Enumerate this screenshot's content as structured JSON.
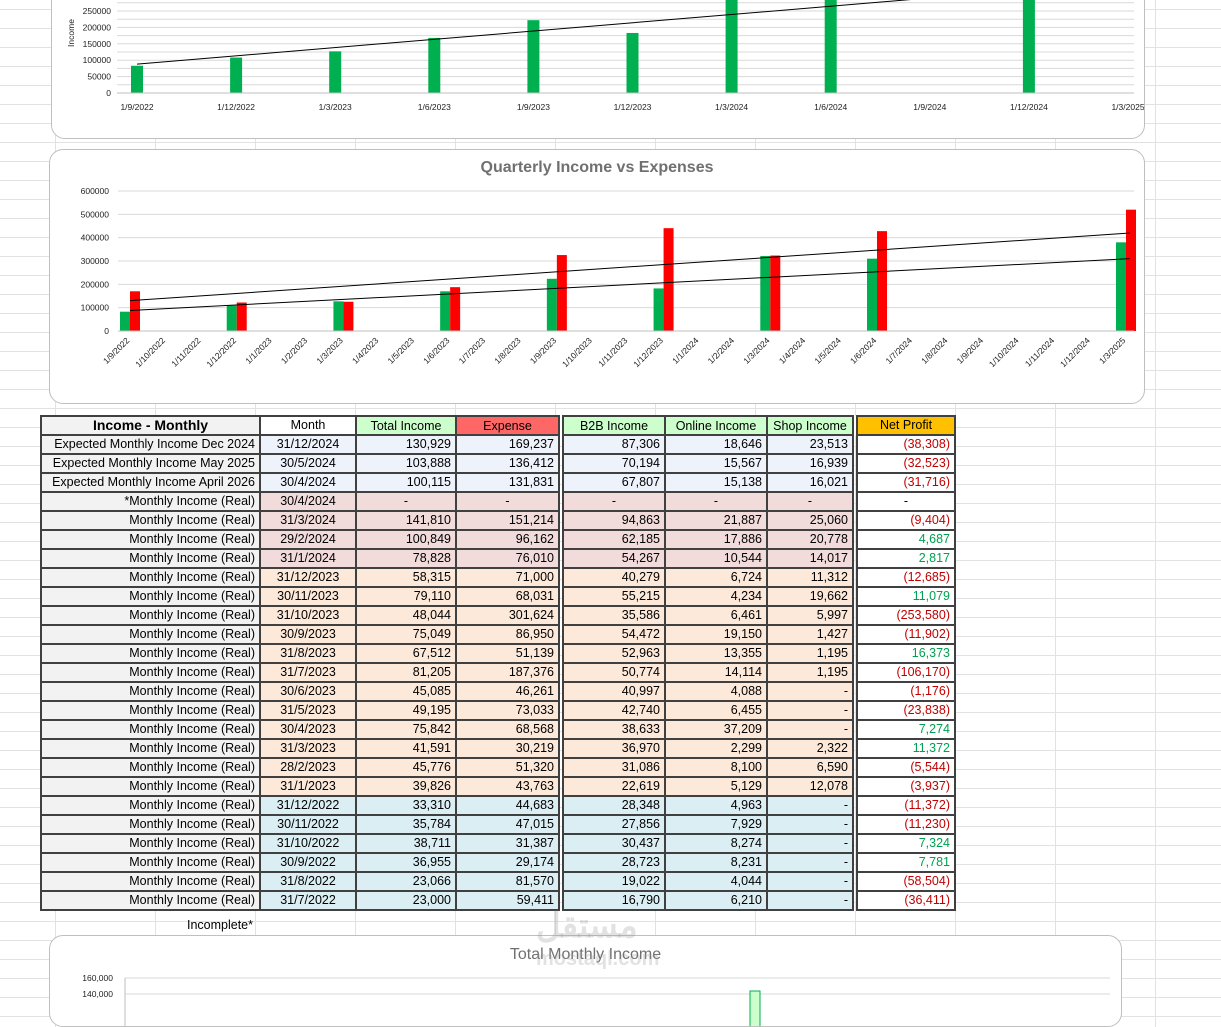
{
  "charts": {
    "top": {
      "ylabel": "Income",
      "y_ticks": [
        "250000",
        "200000",
        "150000",
        "100000",
        "50000",
        "0"
      ],
      "x_ticks": [
        "1/9/2022",
        "1/12/2022",
        "1/3/2023",
        "1/6/2023",
        "1/9/2023",
        "1/12/2023",
        "1/3/2024",
        "1/6/2024",
        "1/9/2024",
        "1/12/2024",
        "1/3/2025"
      ]
    },
    "quarterly": {
      "title": "Quarterly Income vs Expenses",
      "y_ticks": [
        "600000",
        "500000",
        "400000",
        "300000",
        "200000",
        "100000",
        "0"
      ],
      "x_ticks": [
        "1/9/2022",
        "1/10/2022",
        "1/11/2022",
        "1/12/2022",
        "1/1/2023",
        "1/2/2023",
        "1/3/2023",
        "1/4/2023",
        "1/5/2023",
        "1/6/2023",
        "1/7/2023",
        "1/8/2023",
        "1/9/2023",
        "1/10/2023",
        "1/11/2023",
        "1/12/2023",
        "1/1/2024",
        "1/2/2024",
        "1/3/2024",
        "1/4/2024",
        "1/5/2024",
        "1/6/2024",
        "1/7/2024",
        "1/8/2024",
        "1/9/2024",
        "1/10/2024",
        "1/11/2024",
        "1/12/2024",
        "1/3/2025"
      ]
    },
    "bottom": {
      "title": "Total Monthly Income",
      "y_ticks": [
        "160,000",
        "140,000"
      ]
    }
  },
  "chart_data": [
    {
      "type": "bar",
      "title": "",
      "ylabel": "Income",
      "ylim": [
        0,
        250000
      ],
      "categories": [
        "1/9/2022",
        "1/12/2022",
        "1/3/2023",
        "1/6/2023",
        "1/9/2023",
        "1/12/2023",
        "1/3/2024",
        "1/6/2024",
        "1/9/2024",
        "1/12/2024",
        "1/3/2025"
      ],
      "values": [
        83000,
        108000,
        127000,
        168000,
        222000,
        183000,
        290000,
        310000,
        null,
        320000,
        null
      ],
      "trendline": true,
      "colors": {
        "bar": "#00b050"
      }
    },
    {
      "type": "bar",
      "title": "Quarterly Income vs Expenses",
      "ylim": [
        0,
        600000
      ],
      "categories": [
        "1/9/2022",
        "1/12/2022",
        "1/3/2023",
        "1/6/2023",
        "1/9/2023",
        "1/12/2023",
        "1/3/2024",
        "1/6/2024",
        "1/3/2025"
      ],
      "series": [
        {
          "values": [
            82710,
            108805,
            127193,
            170172,
            223761,
            182469,
            321487,
            310000,
            380000
          ],
          "color": "#00b050"
        },
        {
          "values": [
            170155,
            122085,
            125302,
            187862,
            325465,
            440655,
            323386,
            428000,
            520000
          ],
          "color": "#ff0000"
        }
      ],
      "trendlines": true
    }
  ],
  "table": {
    "headers": {
      "label": "Income - Monthly",
      "month": "Month",
      "total_income": "Total Income",
      "expense": "Expense",
      "b2b": "B2B Income",
      "online": "Online Income",
      "shop": "Shop Income",
      "net_profit": "Net Profit"
    },
    "rows": [
      {
        "label": "Expected Monthly Income Dec 2024",
        "month": "31/12/2024",
        "income": "130,929",
        "expense": "169,237",
        "b2b": "87,306",
        "online": "18,646",
        "shop": "23,513",
        "net": "(38,308)",
        "sign": "neg",
        "group": "white"
      },
      {
        "label": "Expected Monthly Income May 2025",
        "month": "30/5/2024",
        "income": "103,888",
        "expense": "136,412",
        "b2b": "70,194",
        "online": "15,567",
        "shop": "16,939",
        "net": "(32,523)",
        "sign": "neg",
        "group": "white"
      },
      {
        "label": "Expected Monthly Income April 2026",
        "month": "30/4/2024",
        "income": "100,115",
        "expense": "131,831",
        "b2b": "67,807",
        "online": "15,138",
        "shop": "16,021",
        "net": "(31,716)",
        "sign": "neg",
        "group": "white"
      },
      {
        "label": "*Monthly Income (Real)",
        "month": "30/4/2024",
        "income": "-",
        "expense": "-",
        "b2b": "-",
        "online": "-",
        "shop": "-",
        "net": "-",
        "sign": "none",
        "group": "pink",
        "center": true
      },
      {
        "label": "Monthly Income (Real)",
        "month": "31/3/2024",
        "income": "141,810",
        "expense": "151,214",
        "b2b": "94,863",
        "online": "21,887",
        "shop": "25,060",
        "net": "(9,404)",
        "sign": "neg",
        "group": "pink"
      },
      {
        "label": "Monthly Income (Real)",
        "month": "29/2/2024",
        "income": "100,849",
        "expense": "96,162",
        "b2b": "62,185",
        "online": "17,886",
        "shop": "20,778",
        "net": "4,687",
        "sign": "pos",
        "group": "pink"
      },
      {
        "label": "Monthly Income (Real)",
        "month": "31/1/2024",
        "income": "78,828",
        "expense": "76,010",
        "b2b": "54,267",
        "online": "10,544",
        "shop": "14,017",
        "net": "2,817",
        "sign": "pos",
        "group": "pink"
      },
      {
        "label": "Monthly Income (Real)",
        "month": "31/12/2023",
        "income": "58,315",
        "expense": "71,000",
        "b2b": "40,279",
        "online": "6,724",
        "shop": "11,312",
        "net": "(12,685)",
        "sign": "neg",
        "group": "peach"
      },
      {
        "label": "Monthly Income (Real)",
        "month": "30/11/2023",
        "income": "79,110",
        "expense": "68,031",
        "b2b": "55,215",
        "online": "4,234",
        "shop": "19,662",
        "net": "11,079",
        "sign": "pos",
        "group": "peach"
      },
      {
        "label": "Monthly Income (Real)",
        "month": "31/10/2023",
        "income": "48,044",
        "expense": "301,624",
        "b2b": "35,586",
        "online": "6,461",
        "shop": "5,997",
        "net": "(253,580)",
        "sign": "neg",
        "group": "peach"
      },
      {
        "label": "Monthly Income (Real)",
        "month": "30/9/2023",
        "income": "75,049",
        "expense": "86,950",
        "b2b": "54,472",
        "online": "19,150",
        "shop": "1,427",
        "net": "(11,902)",
        "sign": "neg",
        "group": "peach"
      },
      {
        "label": "Monthly Income (Real)",
        "month": "31/8/2023",
        "income": "67,512",
        "expense": "51,139",
        "b2b": "52,963",
        "online": "13,355",
        "shop": "1,195",
        "net": "16,373",
        "sign": "pos",
        "group": "peach"
      },
      {
        "label": "Monthly Income (Real)",
        "month": "31/7/2023",
        "income": "81,205",
        "expense": "187,376",
        "b2b": "50,774",
        "online": "14,114",
        "shop": "1,195",
        "net": "(106,170)",
        "sign": "neg",
        "group": "peach"
      },
      {
        "label": "Monthly Income (Real)",
        "month": "30/6/2023",
        "income": "45,085",
        "expense": "46,261",
        "b2b": "40,997",
        "online": "4,088",
        "shop": "-",
        "net": "(1,176)",
        "sign": "neg",
        "group": "peach"
      },
      {
        "label": "Monthly Income (Real)",
        "month": "31/5/2023",
        "income": "49,195",
        "expense": "73,033",
        "b2b": "42,740",
        "online": "6,455",
        "shop": "-",
        "net": "(23,838)",
        "sign": "neg",
        "group": "peach"
      },
      {
        "label": "Monthly Income (Real)",
        "month": "30/4/2023",
        "income": "75,842",
        "expense": "68,568",
        "b2b": "38,633",
        "online": "37,209",
        "shop": "-",
        "net": "7,274",
        "sign": "pos",
        "group": "peach"
      },
      {
        "label": "Monthly Income (Real)",
        "month": "31/3/2023",
        "income": "41,591",
        "expense": "30,219",
        "b2b": "36,970",
        "online": "2,299",
        "shop": "2,322",
        "net": "11,372",
        "sign": "pos",
        "group": "peach"
      },
      {
        "label": "Monthly Income (Real)",
        "month": "28/2/2023",
        "income": "45,776",
        "expense": "51,320",
        "b2b": "31,086",
        "online": "8,100",
        "shop": "6,590",
        "net": "(5,544)",
        "sign": "neg",
        "group": "peach"
      },
      {
        "label": "Monthly Income (Real)",
        "month": "31/1/2023",
        "income": "39,826",
        "expense": "43,763",
        "b2b": "22,619",
        "online": "5,129",
        "shop": "12,078",
        "net": "(3,937)",
        "sign": "neg",
        "group": "peach"
      },
      {
        "label": "Monthly Income (Real)",
        "month": "31/12/2022",
        "income": "33,310",
        "expense": "44,683",
        "b2b": "28,348",
        "online": "4,963",
        "shop": "-",
        "net": "(11,372)",
        "sign": "neg",
        "group": "blue"
      },
      {
        "label": "Monthly Income (Real)",
        "month": "30/11/2022",
        "income": "35,784",
        "expense": "47,015",
        "b2b": "27,856",
        "online": "7,929",
        "shop": "-",
        "net": "(11,230)",
        "sign": "neg",
        "group": "blue"
      },
      {
        "label": "Monthly Income (Real)",
        "month": "31/10/2022",
        "income": "38,711",
        "expense": "31,387",
        "b2b": "30,437",
        "online": "8,274",
        "shop": "-",
        "net": "7,324",
        "sign": "pos",
        "group": "blue"
      },
      {
        "label": "Monthly Income (Real)",
        "month": "30/9/2022",
        "income": "36,955",
        "expense": "29,174",
        "b2b": "28,723",
        "online": "8,231",
        "shop": "-",
        "net": "7,781",
        "sign": "pos",
        "group": "blue"
      },
      {
        "label": "Monthly Income (Real)",
        "month": "31/8/2022",
        "income": "23,066",
        "expense": "81,570",
        "b2b": "19,022",
        "online": "4,044",
        "shop": "-",
        "net": "(58,504)",
        "sign": "neg",
        "group": "blue"
      },
      {
        "label": "Monthly Income (Real)",
        "month": "31/7/2022",
        "income": "23,000",
        "expense": "59,411",
        "b2b": "16,790",
        "online": "6,210",
        "shop": "-",
        "net": "(36,411)",
        "sign": "neg",
        "group": "blue"
      }
    ],
    "footnote": "Incomplete*"
  },
  "watermark": {
    "arabic": "مستقل",
    "latin": "mostaql.com"
  }
}
